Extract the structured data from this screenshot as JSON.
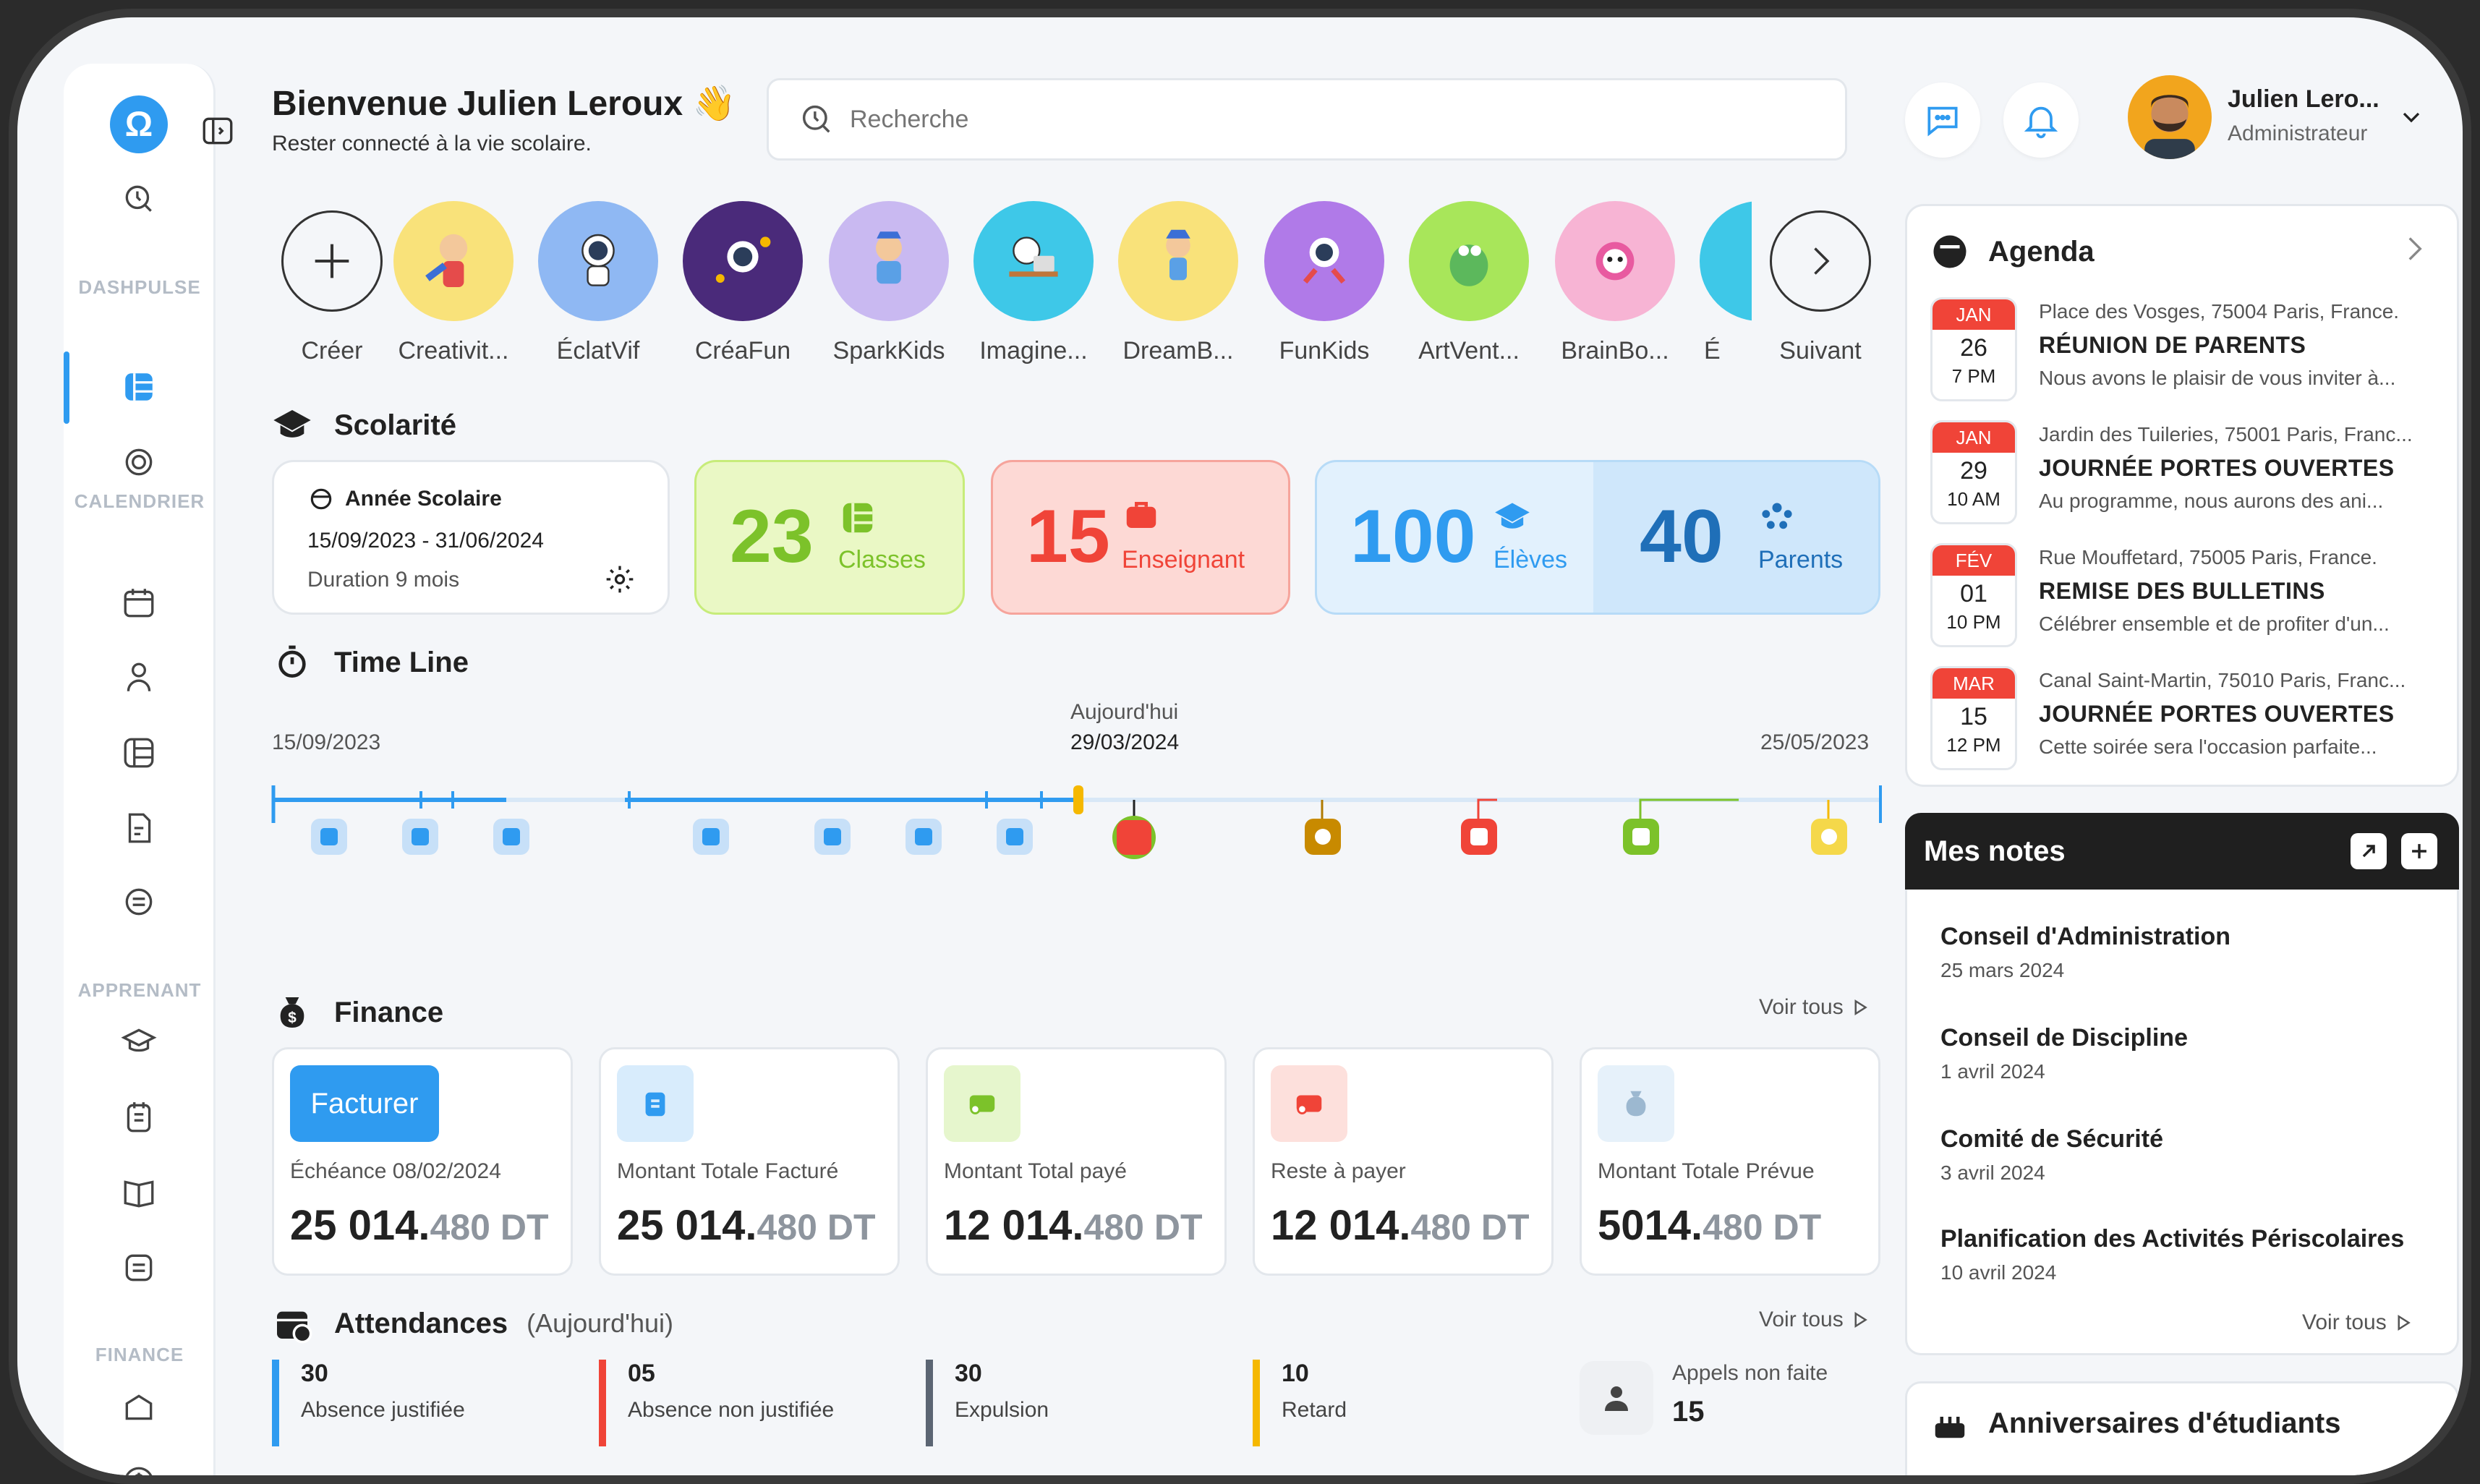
{
  "header": {
    "title": "Bienvenue Julien Leroux",
    "title_emoji": "👋",
    "subtitle": "Rester connecté à la vie scolaire."
  },
  "search": {
    "placeholder": "Recherche"
  },
  "user": {
    "name": "Julien Lero...",
    "role": "Administrateur"
  },
  "sidebar": {
    "sections": [
      "DASHPULSE",
      "CALENDRIER",
      "APPRENANT",
      "FINANCE"
    ]
  },
  "stories": [
    {
      "label": "Créer",
      "icon": "plus-icon"
    },
    {
      "label": "Creativit...",
      "color": "#f9e27a"
    },
    {
      "label": "ÉclatVif",
      "color": "#8fb8f3"
    },
    {
      "label": "CréaFun",
      "color": "#4a2a7a"
    },
    {
      "label": "SparkKids",
      "color": "#c9b9f1"
    },
    {
      "label": "Imagine...",
      "color": "#3ec8e8"
    },
    {
      "label": "DreamB...",
      "color": "#f9e27a"
    },
    {
      "label": "FunKids",
      "color": "#b07ae8"
    },
    {
      "label": "ArtVent...",
      "color": "#a8e65a"
    },
    {
      "label": "BrainBo...",
      "color": "#f7b4d4"
    },
    {
      "label": "É",
      "color": "#3ec8e8"
    },
    {
      "label": "Suivant",
      "icon": "chevron-right-icon"
    }
  ],
  "scolarite": {
    "title": "Scolarité",
    "annee_label": "Année Scolaire",
    "annee_range": "15/09/2023 - 31/06/2024",
    "duration": "Duration 9 mois",
    "classes_num": "23",
    "classes_label": "Classes",
    "enseignant_num": "15",
    "enseignant_label": "Enseignant",
    "eleves_num": "100",
    "eleves_label": "Élèves",
    "parents_num": "40",
    "parents_label": "Parents"
  },
  "timeline": {
    "title": "Time Line",
    "start": "15/09/2023",
    "today_label": "Aujourd'hui",
    "today": "29/03/2024",
    "end": "25/05/2023"
  },
  "finance": {
    "title": "Finance",
    "voir_tous": "Voir tous",
    "facturer": "Facturer",
    "cards": [
      {
        "label": "Échéance 08/02/2024",
        "int": "25 014.",
        "dec": "480 DT"
      },
      {
        "label": "Montant Totale Facturé",
        "int": "25 014.",
        "dec": "480 DT"
      },
      {
        "label": "Montant Total payé",
        "int": "12 014.",
        "dec": "480 DT"
      },
      {
        "label": "Reste à payer",
        "int": "12 014.",
        "dec": "480 DT"
      },
      {
        "label": "Montant Totale Prévue",
        "int": "5014.",
        "dec": "480 DT"
      }
    ]
  },
  "attendances": {
    "title": "Attendances",
    "subtitle": "(Aujourd'hui)",
    "voir_tous": "Voir tous",
    "items": [
      {
        "num": "30",
        "label": "Absence justifiée",
        "color": "#2f9bf0"
      },
      {
        "num": "05",
        "label": "Absence non justifiée",
        "color": "#f04438"
      },
      {
        "num": "30",
        "label": "Expulsion",
        "color": "#5b6573"
      },
      {
        "num": "10",
        "label": "Retard",
        "color": "#f5b800"
      }
    ],
    "appels_label": "Appels non faite",
    "appels_num": "15"
  },
  "agenda": {
    "title": "Agenda",
    "items": [
      {
        "mon": "JAN",
        "day": "26",
        "time": "7 PM",
        "loc": "Place des Vosges, 75004 Paris, France.",
        "title": "RÉUNION DE PARENTS",
        "desc": "Nous avons le plaisir de vous inviter à..."
      },
      {
        "mon": "JAN",
        "day": "29",
        "time": "10 AM",
        "loc": "Jardin des Tuileries, 75001 Paris, Franc...",
        "title": "JOURNÉE PORTES OUVERTES",
        "desc": "Au programme, nous aurons des ani..."
      },
      {
        "mon": "FÉV",
        "day": "01",
        "time": "10 PM",
        "loc": "Rue Mouffetard, 75005 Paris, France.",
        "title": "REMISE DES BULLETINS",
        "desc": "Célébrer ensemble et de profiter d'un..."
      },
      {
        "mon": "MAR",
        "day": "15",
        "time": "12 PM",
        "loc": "Canal Saint-Martin, 75010 Paris, Franc...",
        "title": "JOURNÉE PORTES OUVERTES",
        "desc": "Cette soirée sera l'occasion parfaite..."
      }
    ]
  },
  "notes": {
    "title": "Mes notes",
    "voir_tous": "Voir tous",
    "items": [
      {
        "title": "Conseil d'Administration",
        "date": "25 mars 2024"
      },
      {
        "title": "Conseil de Discipline",
        "date": "1 avril 2024"
      },
      {
        "title": "Comité de Sécurité",
        "date": "3 avril 2024"
      },
      {
        "title": "Planification des Activités Périscolaires",
        "date": "10 avril 2024"
      }
    ]
  },
  "anniversaires": {
    "title": "Anniversaires d'étudiants"
  }
}
